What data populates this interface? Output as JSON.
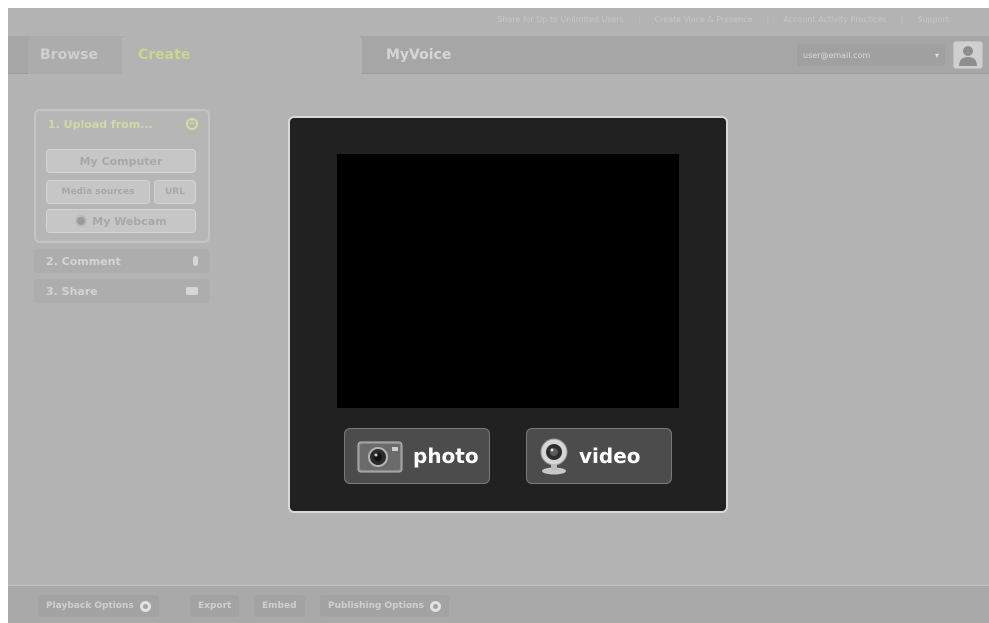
{
  "toplinks": [
    "Share for Up to Unlimited Users",
    "Create Voice & Presence",
    "Account Activity Practices",
    "Support"
  ],
  "tabs": {
    "browse": "Browse",
    "create": "Create",
    "myvoice": "MyVoice"
  },
  "account": {
    "email": "user@email.com",
    "caret": "▾"
  },
  "steps": {
    "upload_title": "1. Upload from...",
    "my_computer": "My Computer",
    "media_sources": "Media sources",
    "url": "URL",
    "my_webcam": "My Webcam",
    "comment": "2. Comment",
    "share": "3. Share"
  },
  "capture": {
    "photo_label": "photo",
    "video_label": "video"
  },
  "footer": {
    "playback": "Playback Options",
    "export": "Export",
    "embed": "Embed",
    "publishing": "Publishing Options"
  },
  "colors": {
    "background": "#b3b3b3",
    "panel": "#212121",
    "accent": "#ccd58a"
  }
}
